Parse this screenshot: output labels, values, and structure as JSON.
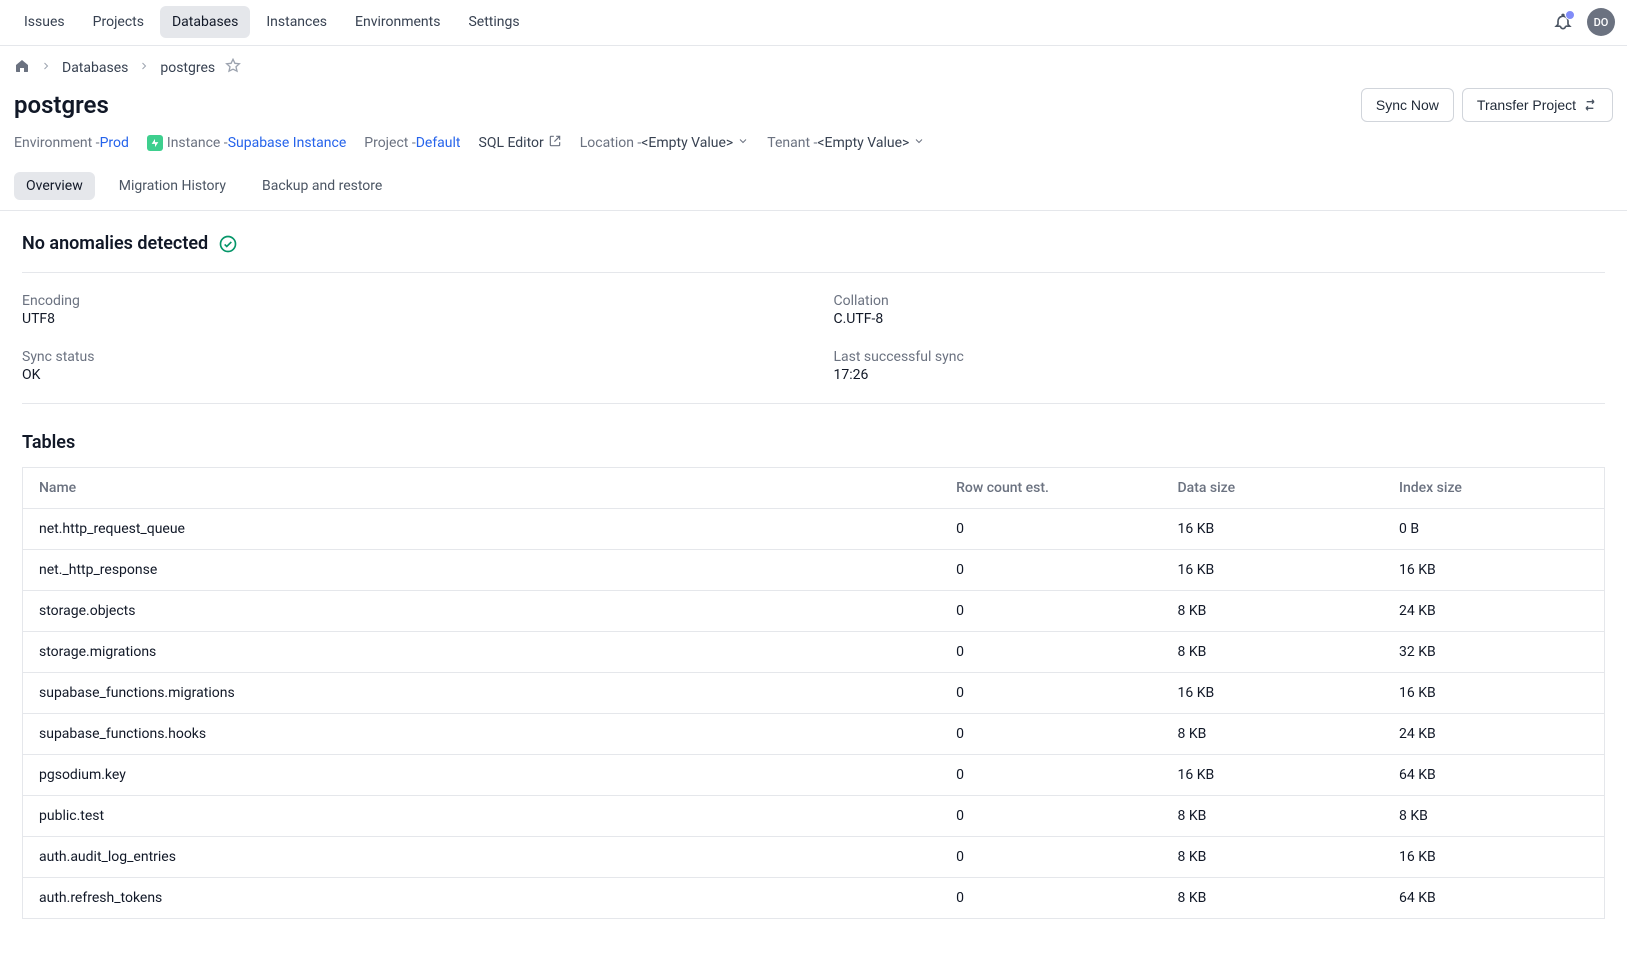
{
  "nav": {
    "items": [
      "Issues",
      "Projects",
      "Databases",
      "Instances",
      "Environments",
      "Settings"
    ],
    "active_index": 2,
    "avatar_initials": "DO"
  },
  "breadcrumb": {
    "items": [
      {
        "label": "Databases"
      },
      {
        "label": "postgres"
      }
    ]
  },
  "header": {
    "title": "postgres",
    "sync_button": "Sync Now",
    "transfer_button": "Transfer Project"
  },
  "meta": {
    "environment_label": "Environment - ",
    "environment_value": "Prod",
    "instance_label": "Instance - ",
    "instance_value": "Supabase Instance",
    "project_label": "Project - ",
    "project_value": "Default",
    "sql_editor": "SQL Editor",
    "location_label": "Location - ",
    "location_value": "<Empty Value>",
    "tenant_label": "Tenant - ",
    "tenant_value": "<Empty Value>"
  },
  "tabs": {
    "items": [
      "Overview",
      "Migration History",
      "Backup and restore"
    ],
    "active_index": 0
  },
  "anomaly": {
    "text": "No anomalies detected"
  },
  "info": {
    "encoding_label": "Encoding",
    "encoding_value": "UTF8",
    "collation_label": "Collation",
    "collation_value": "C.UTF-8",
    "sync_status_label": "Sync status",
    "sync_status_value": "OK",
    "last_sync_label": "Last successful sync",
    "last_sync_value": "17:26"
  },
  "tables": {
    "heading": "Tables",
    "columns": [
      "Name",
      "Row count est.",
      "Data size",
      "Index size"
    ],
    "rows": [
      {
        "name": "net.http_request_queue",
        "row_count": "0",
        "data_size": "16 KB",
        "index_size": "0 B"
      },
      {
        "name": "net._http_response",
        "row_count": "0",
        "data_size": "16 KB",
        "index_size": "16 KB"
      },
      {
        "name": "storage.objects",
        "row_count": "0",
        "data_size": "8 KB",
        "index_size": "24 KB"
      },
      {
        "name": "storage.migrations",
        "row_count": "0",
        "data_size": "8 KB",
        "index_size": "32 KB"
      },
      {
        "name": "supabase_functions.migrations",
        "row_count": "0",
        "data_size": "16 KB",
        "index_size": "16 KB"
      },
      {
        "name": "supabase_functions.hooks",
        "row_count": "0",
        "data_size": "8 KB",
        "index_size": "24 KB"
      },
      {
        "name": "pgsodium.key",
        "row_count": "0",
        "data_size": "16 KB",
        "index_size": "64 KB"
      },
      {
        "name": "public.test",
        "row_count": "0",
        "data_size": "8 KB",
        "index_size": "8 KB"
      },
      {
        "name": "auth.audit_log_entries",
        "row_count": "0",
        "data_size": "8 KB",
        "index_size": "16 KB"
      },
      {
        "name": "auth.refresh_tokens",
        "row_count": "0",
        "data_size": "8 KB",
        "index_size": "64 KB"
      }
    ]
  }
}
